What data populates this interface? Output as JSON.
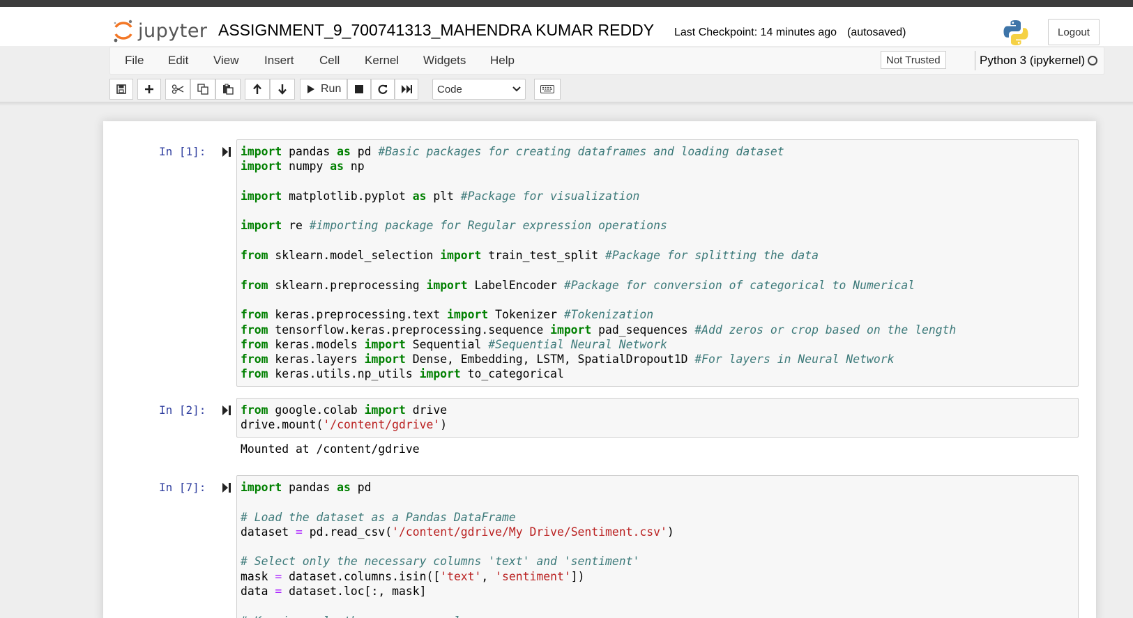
{
  "header": {
    "logo_text": "jupyter",
    "notebook_title": "ASSIGNMENT_9_700741313_MAHENDRA KUMAR REDDY",
    "checkpoint": "Last Checkpoint: 14 minutes ago",
    "autosave": "(autosaved)",
    "logout_label": "Logout"
  },
  "menu": {
    "items": [
      "File",
      "Edit",
      "View",
      "Insert",
      "Cell",
      "Kernel",
      "Widgets",
      "Help"
    ],
    "trust_label": "Not Trusted",
    "kernel_label": "Python 3 (ipykernel)"
  },
  "toolbar": {
    "run_label": "Run",
    "cell_type": "Code",
    "icons": [
      "save-icon",
      "plus-icon",
      "scissors-icon",
      "copy-icon",
      "paste-icon",
      "arrow-up-icon",
      "arrow-down-icon",
      "play-icon",
      "stop-icon",
      "restart-icon",
      "fast-forward-icon",
      "keyboard-icon"
    ]
  },
  "colors": {
    "keyword": "#008000",
    "comment": "#3d7a7a",
    "string": "#ba2121",
    "operator": "#aa22ff",
    "prompt": "#303f9f"
  },
  "cells": [
    {
      "prompt": "In [1]:",
      "lines": [
        [
          [
            "kw",
            "import"
          ],
          [
            "",
            "pandas "
          ],
          [
            "kw",
            "as"
          ],
          [
            "",
            "pd "
          ],
          [
            "cm",
            "#Basic packages for creating dataframes and loading dataset"
          ]
        ],
        [
          [
            "kw",
            "import"
          ],
          [
            "",
            "numpy "
          ],
          [
            "kw",
            "as"
          ],
          [
            "",
            "np"
          ]
        ],
        [],
        [
          [
            "kw",
            "import"
          ],
          [
            "",
            "matplotlib.pyplot "
          ],
          [
            "kw",
            "as"
          ],
          [
            "",
            "plt "
          ],
          [
            "cm",
            "#Package for visualization"
          ]
        ],
        [],
        [
          [
            "kw",
            "import"
          ],
          [
            "",
            "re "
          ],
          [
            "cm",
            "#importing package for Regular expression operations"
          ]
        ],
        [],
        [
          [
            "kw",
            "from"
          ],
          [
            "",
            "sklearn.model_selection "
          ],
          [
            "kw",
            "import"
          ],
          [
            "",
            "train_test_split "
          ],
          [
            "cm",
            "#Package for splitting the data"
          ]
        ],
        [],
        [
          [
            "kw",
            "from"
          ],
          [
            "",
            "sklearn.preprocessing "
          ],
          [
            "kw",
            "import"
          ],
          [
            "",
            "LabelEncoder "
          ],
          [
            "cm",
            "#Package for conversion of categorical to Numerical"
          ]
        ],
        [],
        [
          [
            "kw",
            "from"
          ],
          [
            "",
            "keras.preprocessing.text "
          ],
          [
            "kw",
            "import"
          ],
          [
            "",
            "Tokenizer "
          ],
          [
            "cm",
            "#Tokenization"
          ]
        ],
        [
          [
            "kw",
            "from"
          ],
          [
            "",
            "tensorflow.keras.preprocessing.sequence "
          ],
          [
            "kw",
            "import"
          ],
          [
            "",
            "pad_sequences "
          ],
          [
            "cm",
            "#Add zeros or crop based on the length"
          ]
        ],
        [
          [
            "kw",
            "from"
          ],
          [
            "",
            "keras.models "
          ],
          [
            "kw",
            "import"
          ],
          [
            "",
            "Sequential "
          ],
          [
            "cm",
            "#Sequential Neural Network"
          ]
        ],
        [
          [
            "kw",
            "from"
          ],
          [
            "",
            "keras.layers "
          ],
          [
            "kw",
            "import"
          ],
          [
            "",
            "Dense, Embedding, LSTM, SpatialDropout1D "
          ],
          [
            "cm",
            "#For layers in Neural Network"
          ]
        ],
        [
          [
            "kw",
            "from"
          ],
          [
            "",
            "keras.utils.np_utils "
          ],
          [
            "kw",
            "import"
          ],
          [
            "",
            "to_categorical"
          ]
        ]
      ]
    },
    {
      "prompt": "In [2]:",
      "lines": [
        [
          [
            "kw",
            "from"
          ],
          [
            "",
            "google.colab "
          ],
          [
            "kw",
            "import"
          ],
          [
            "",
            "drive"
          ]
        ],
        [
          [
            "",
            "drive.mount("
          ],
          [
            "st",
            "'/content/gdrive'"
          ],
          [
            "",
            ")"
          ]
        ]
      ],
      "output": "Mounted at /content/gdrive"
    },
    {
      "prompt": "In [7]:",
      "lines": [
        [
          [
            "kw",
            "import"
          ],
          [
            "",
            "pandas "
          ],
          [
            "kw",
            "as"
          ],
          [
            "",
            "pd"
          ]
        ],
        [],
        [
          [
            "cm",
            "# Load the dataset as a Pandas DataFrame"
          ]
        ],
        [
          [
            "",
            "dataset "
          ],
          [
            "op",
            "="
          ],
          [
            "",
            "pd.read_csv("
          ],
          [
            "st",
            "'/content/gdrive/My Drive/Sentiment.csv'"
          ],
          [
            "",
            ")"
          ]
        ],
        [],
        [
          [
            "cm",
            "# Select only the necessary columns 'text' and 'sentiment'"
          ]
        ],
        [
          [
            "",
            "mask "
          ],
          [
            "op",
            "="
          ],
          [
            "",
            "dataset.columns.isin(["
          ],
          [
            "st",
            "'text'"
          ],
          [
            "",
            ", "
          ],
          [
            "st",
            "'sentiment'"
          ],
          [
            "",
            "])"
          ]
        ],
        [
          [
            "",
            "data "
          ],
          [
            "op",
            "="
          ],
          [
            "",
            "dataset.loc[:, mask]"
          ]
        ],
        [],
        [
          [
            "cm",
            "# Keeping only the necessary columns"
          ]
        ]
      ]
    }
  ]
}
